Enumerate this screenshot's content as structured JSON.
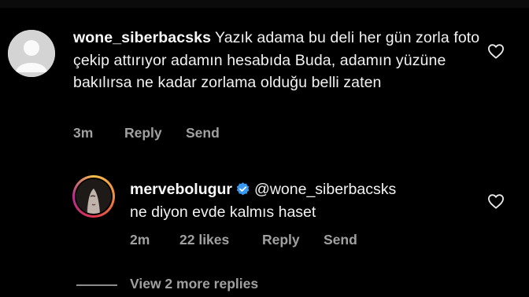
{
  "comment": {
    "username": "wone_siberbacsks",
    "text": "Yazık adama bu deli her gün zorla foto çekip attırıyor adamın hesabıda Buda, adamın yüzüne bakılırsa ne kadar zorlama olduğu belli zaten",
    "time": "3m",
    "reply_label": "Reply",
    "send_label": "Send"
  },
  "reply": {
    "username": "mervebolugur",
    "mention": "@wone_siberbacsks",
    "text": "ne diyon evde kalmıs haset",
    "time": "2m",
    "likes": "22 likes",
    "reply_label": "Reply",
    "send_label": "Send"
  },
  "view_more_label": "View 2 more replies",
  "colors": {
    "background": "#000000",
    "text": "#f2f2f2",
    "meta": "#a0a0a0",
    "verified": "#3897f0",
    "story_ring": [
      "#f5c04b",
      "#e0364f",
      "#b52b8e"
    ]
  },
  "icons": {
    "default_avatar": "default-avatar-icon",
    "heart": "heart-outline-icon",
    "verified": "verified-badge-icon"
  }
}
